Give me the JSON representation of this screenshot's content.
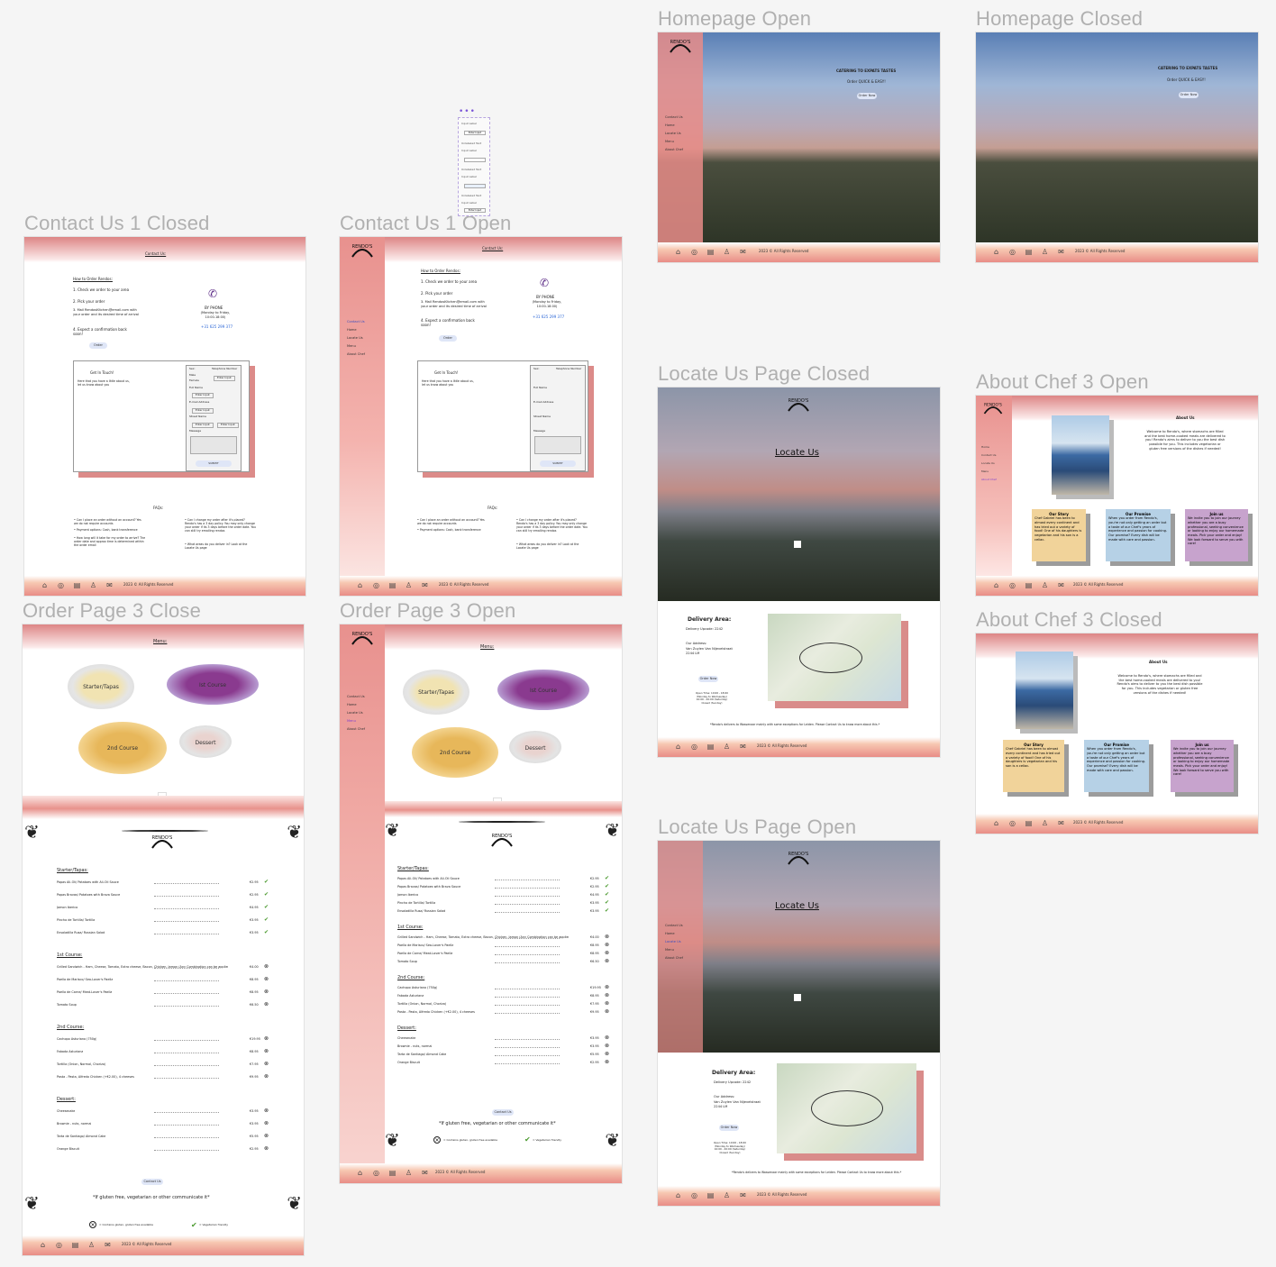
{
  "labels": {
    "homepage_open": "Homepage  Open",
    "homepage_closed": "Homepage Closed",
    "contact_closed": "Contact Us 1 Closed",
    "contact_open": "Contact Us 1 Open",
    "locate_closed": "Locate Us Page Closed",
    "about_open": "About Chef 3 Open",
    "about_closed": "About Chef 3 Closed",
    "order_close": "Order Page 3 Close",
    "order_open": "Order Page 3 Open",
    "locate_open": "Locate Us Page Open"
  },
  "brand": "RENDO'S",
  "footer": {
    "copyright": "2023 © All Rights Reserved"
  },
  "sidebar": [
    "Contact Us",
    "Home",
    "Locate Us",
    "Menu",
    "About Chef"
  ],
  "home": {
    "tagline": "CATERING TO EXPATS TASTES",
    "sub": "Order QUICK & EASY!",
    "cta": "Order Now"
  },
  "contact": {
    "title": "Contact Us:",
    "how": "How to Order Rendos:",
    "steps": [
      "1. Check we order to your area",
      "2. Pick your order",
      "3. Mail RendosKitchen@email.com with your order and its desired time of arrival",
      "4. Expect a confirmation back soon!"
    ],
    "order_btn": "Order",
    "phone_title": "BY PHONE",
    "phone_hours": "(Monday to Friday, 10:00-18:00)",
    "phone_no": "+31 625 299 377",
    "get_in_touch": "Get In Touch!",
    "git_text": "Here that you have a little about us, let us know about you",
    "sex": "Sex:",
    "male": "Male",
    "female": "Female",
    "tel": "Telephone Number",
    "full_name": "Full Name",
    "email": "E-mail Address",
    "street": "Street Name",
    "message": "Message",
    "enter": "Enter Input",
    "submit": "SUBMIT",
    "faqs": "FAQs:",
    "faq_left": [
      "• Can I place an order without an account? Yes we do not require accounts",
      "• Payment options: Cash, bank transference",
      "• How long will it take for my order to arrive? The order date and approx time is determined within the order email"
    ],
    "faq_right": [
      "• Can I change my order after it's placed? Rendo's has a 3 day policy. You may only change your order if its 3 days before the order date. You can still try emailing rendos",
      "• Can I only get it from far-ish or under 3 days left but there is no guarantee",
      "• What areas do you deliver in? Look at the Locate Us page"
    ]
  },
  "wire": {
    "labels": [
      "Input Label",
      "Enter Input",
      "Unlabeled Text",
      "Input Label",
      "Unlabeled Text",
      "Input Label",
      "Unlabeled Text",
      "Input Label",
      "Enter Input"
    ]
  },
  "locate": {
    "title": "Locate Us",
    "delivery_title": "Delivery Area:",
    "delivery": "Delivery Upcode: 2242",
    "address_title": "Our Address:",
    "address": "Van Zuylen Van Nijevelstraat 2244 LM",
    "btn": "Order Now",
    "hours": "Open Time: 10:00 - 18:00 (Monday to Wednesday) 10:00 - 20:00 (Saturday) Closed (Sunday)",
    "note": "*Rendo's delivers to Wassenaar mainly with some exceptions for Leiden. Please Contact Us to know more about this.*"
  },
  "about": {
    "title": "About Us",
    "intro": "Welcome to Rendo's, where stomachs are filled and the best home-cooked meals are delivered to you! Rendo's aims to deliver to you the best dish possible for you. This includes vegetarian or gluten free versions of the dishes if needed!",
    "cards": [
      {
        "title": "Our Story",
        "text": "Chef Gabriel has been to almost every continent and has tried out a variety of food! One of his daughters is vegetarian and his son is a celiac."
      },
      {
        "title": "Our Promise",
        "text": "When you order from Rendo's, you're not only getting an order but a taste of our Chef's years of experience and passion for cooking. Our promise? Every dish will be made with care and passion."
      },
      {
        "title": "Join us",
        "text": "We invite you to join our journey whether you are a busy professional, seeking convenience or looking to enjoy our homemade meals. Pick your order and enjoy! We look forward to serve you with care!"
      }
    ]
  },
  "menu": {
    "title": "Menu:",
    "plates": [
      "Starter/Tapas",
      "Ist Course",
      "2nd Course",
      "Dessert"
    ],
    "sections": [
      {
        "name": "Starter/Tapas:",
        "items": [
          [
            "Papas Ali-Oli/ Potatoes with Ali-Oli Sauce",
            "€2.95"
          ],
          [
            "Papas Bravas/ Potatoes with Brava Sauce",
            "€2.95"
          ],
          [
            "Jamon Iberico",
            "€4.95"
          ],
          [
            "Pincho de Tortilla/ Tortilla",
            "€3.95"
          ],
          [
            "Ensaladilla Rusa/ Russian Salad",
            "€3.95"
          ]
        ]
      },
      {
        "name": "1st Course:",
        "items": [
          [
            "Grilled Sandwich - Ham, Cheese, Tomato, Extra cheese, Bacon, Chicken, Jamon (Any Combination can be applied, Each ingredient + €0.25)",
            "€4.00"
          ],
          [
            "Paella de Marisco/ Sea-Lover's Paella",
            "€8.95"
          ],
          [
            "Paella de Carne/ Meat-Lover's Paella",
            "€8.95"
          ],
          [
            "Tomato Soup",
            "€6.50"
          ]
        ]
      },
      {
        "name": "2nd Course:",
        "items": [
          [
            "Cachopo Asturiano (750g)",
            "€19.95"
          ],
          [
            "Fabada Asturiana",
            "€8.95"
          ],
          [
            "Tortilla (Onion, Normal, Chorizo)",
            "€7.95"
          ],
          [
            "Pasta - Pasta, Alfredo Chicken (+€2.00), 4 cheeses",
            "€9.95"
          ]
        ]
      },
      {
        "name": "Dessert:",
        "items": [
          [
            "Cheesecake",
            "€3.95"
          ],
          [
            "Brownie - nuts, normal",
            "€3.95"
          ],
          [
            "Tarta de Santiago/ Almond Cake",
            "€5.95"
          ],
          [
            "Orange Biscuit",
            "€2.95"
          ]
        ]
      }
    ],
    "contact_btn": "Contact Us",
    "note": "*If gluten free, vegetarian or other communicate it*",
    "legend_gluten": "= Contains gluten, gluten free available",
    "legend_veg": "= Vegetarian friendly"
  }
}
